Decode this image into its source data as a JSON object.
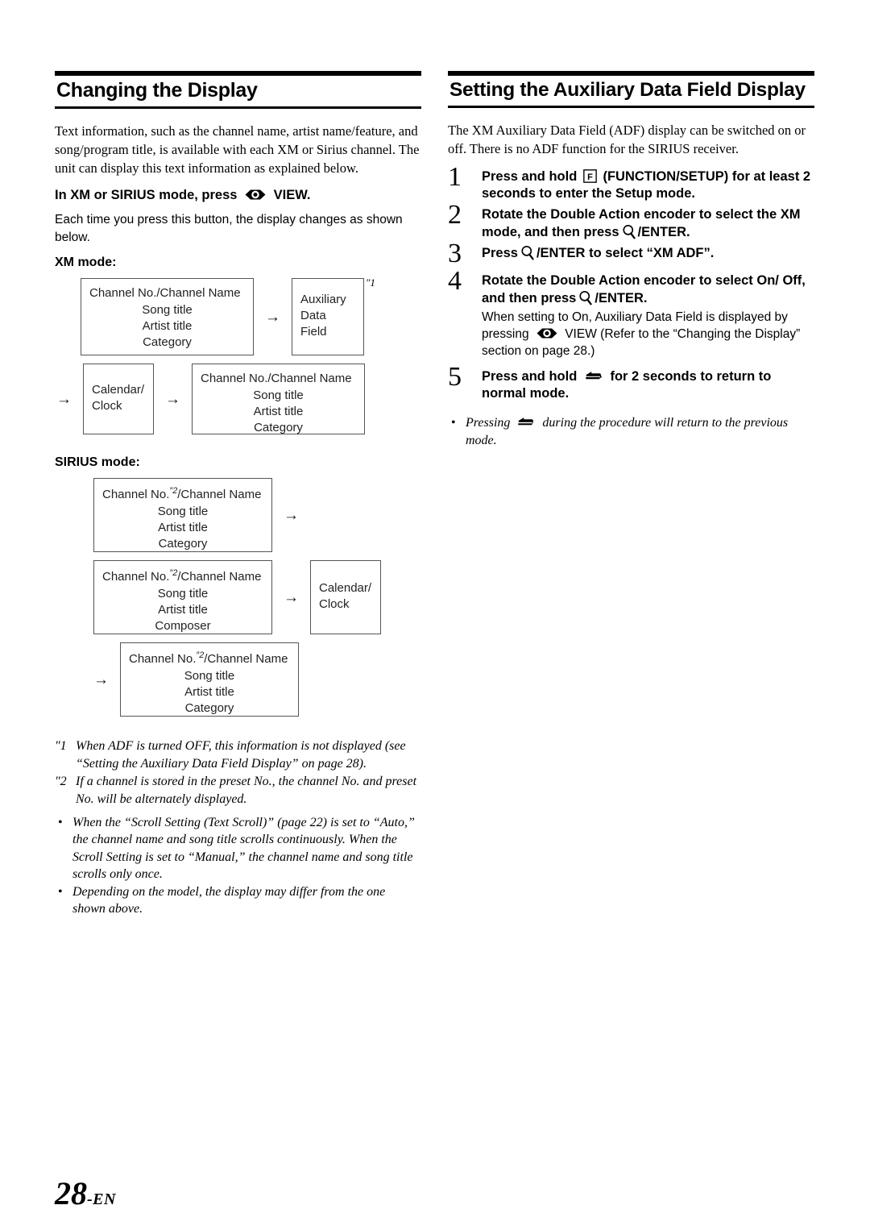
{
  "page": {
    "number_label": "28",
    "lang_suffix": "-EN"
  },
  "left": {
    "heading": "Changing the Display",
    "intro": "Text information, such as the channel name, artist name/feature, and song/program title, is available with each XM or Sirius channel. The unit can display this text information as explained below.",
    "press_line_prefix": "In XM or SIRIUS mode, press",
    "press_line_suffix": "VIEW.",
    "each_time": "Each time you press this button, the display changes as shown below.",
    "xm_mode_label": "XM mode:",
    "sirius_mode_label": "SIRIUS mode:",
    "xm_flow": {
      "box1": {
        "title": "Channel No./Channel Name",
        "lines": [
          "Song title",
          "Artist title",
          "Category"
        ]
      },
      "arrow1": "→",
      "box2": {
        "lines": [
          "Auxiliary",
          "Data Field"
        ],
        "footnote_mark": "″1"
      },
      "arrow2": "→",
      "box3": {
        "lines": [
          "Calendar/",
          "Clock"
        ]
      },
      "arrow3": "→",
      "box4": {
        "title": "Channel No./Channel Name",
        "lines": [
          "Song title",
          "Artist title",
          "Category"
        ]
      }
    },
    "sirius_flow": {
      "box1": {
        "title_pre": "Channel No.",
        "title_mark": "″2",
        "title_post": "/Channel Name",
        "lines": [
          "Song title",
          "Artist title",
          "Category"
        ]
      },
      "arrow1": "→",
      "box2": {
        "title_pre": "Channel No.",
        "title_mark": "″2",
        "title_post": "/Channel Name",
        "lines": [
          "Song title",
          "Artist title",
          "Composer"
        ]
      },
      "arrow2": "→",
      "box3": {
        "lines": [
          "Calendar/",
          "Clock"
        ]
      },
      "arrow3": "→",
      "box4": {
        "title_pre": "Channel No.",
        "title_mark": "″2",
        "title_post": "/Channel Name",
        "lines": [
          "Song title",
          "Artist title",
          "Category"
        ]
      }
    },
    "footnotes": [
      {
        "mark": "″1",
        "text": "When ADF is turned OFF, this information is not displayed (see “Setting the Auxiliary Data Field Display” on page 28)."
      },
      {
        "mark": "″2",
        "text": "If a channel is stored in the preset No., the channel No. and preset No. will be alternately displayed."
      }
    ],
    "notes": [
      "When the “Scroll Setting (Text Scroll)” (page 22) is set to “Auto,” the channel name and song title scrolls continuously. When the Scroll Setting is set to “Manual,” the channel name and song title scrolls only once.",
      "Depending on the model, the display may differ from the one shown above."
    ]
  },
  "right": {
    "heading": "Setting the Auxiliary Data Field Display",
    "intro": "The XM Auxiliary Data Field (ADF) display can be switched on or off. There is no ADF function for the SIRIUS receiver.",
    "steps": [
      {
        "num": "1",
        "part_a": "Press and hold",
        "part_b": "(FUNCTION/SETUP)",
        "part_c": "for at least 2 seconds to enter the Setup mode."
      },
      {
        "num": "2",
        "part_a": "Rotate the",
        "part_b": "Double Action encoder",
        "part_c": "to select the XM mode, and then press",
        "part_d": "/ENTER."
      },
      {
        "num": "3",
        "part_a": "Press",
        "part_b": "/ENTER",
        "part_c": "to select “XM ADF”."
      },
      {
        "num": "4",
        "part_a": "Rotate the",
        "part_b": "Double Action encoder",
        "part_c": "to select On/ Off, and then press",
        "part_d": "/ENTER.",
        "sub_a": "When setting to On, Auxiliary Data Field is displayed by pressing",
        "sub_b": "VIEW",
        "sub_c": "(Refer to the “Changing the Display” section on page 28.)"
      },
      {
        "num": "5",
        "part_a": "Press and hold",
        "part_c": "for 2 seconds to  return to normal mode."
      }
    ],
    "note_a": "Pressing",
    "note_b": "during the procedure will return to the previous mode."
  },
  "icons": {
    "eye": "eye-view-icon",
    "function_f": "function-setup-f-icon",
    "magnifier": "magnifier-enter-icon",
    "back": "back-return-icon",
    "arrow_right": "→"
  }
}
